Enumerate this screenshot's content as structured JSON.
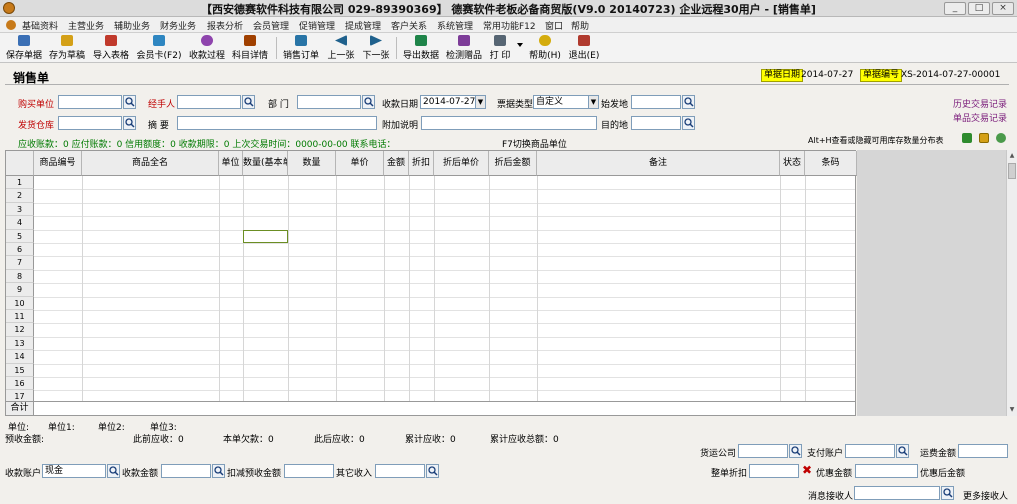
{
  "window": {
    "title": "【西安德赛软件科技有限公司 029-89390369】 德赛软件老板必备商贸版(V9.0 20140723) 企业远程30用户 - [销售单]",
    "controls": [
      "_",
      "□",
      "×"
    ]
  },
  "menu": [
    "基础资料",
    "主营业务",
    "辅助业务",
    "财务业务",
    "报表分析",
    "会员管理",
    "促销管理",
    "提成管理",
    "客户关系",
    "系统管理",
    "常用功能F12",
    "窗口",
    "帮助"
  ],
  "toolbar": [
    {
      "label": "保存单据",
      "icon": "save-icon",
      "color": "#3a6fb5"
    },
    {
      "label": "存为草稿",
      "icon": "draft-icon",
      "color": "#d4a017"
    },
    {
      "label": "导入表格",
      "icon": "import-icon",
      "color": "#c0392b"
    },
    {
      "label": "会员卡(F2)",
      "icon": "member-card-icon",
      "color": "#2e86c1"
    },
    {
      "label": "收款过程",
      "icon": "payment-icon",
      "color": "#8e44ad"
    },
    {
      "label": "科目详情",
      "icon": "subject-detail-icon",
      "color": "#a04000"
    },
    {
      "label": "销售订单",
      "icon": "sales-order-icon",
      "color": "#2874a6"
    },
    {
      "label": "上一张",
      "icon": "prev-icon",
      "color": "#1f618d"
    },
    {
      "label": "下一张",
      "icon": "next-icon",
      "color": "#1f618d"
    },
    {
      "label": "导出数据",
      "icon": "export-icon",
      "color": "#1e8449"
    },
    {
      "label": "检测赠品",
      "icon": "gift-check-icon",
      "color": "#7d3c98"
    },
    {
      "label": "打 印",
      "icon": "print-icon",
      "color": "#566573"
    },
    {
      "label": "帮助(H)",
      "icon": "help-icon",
      "color": "#d4ac0d"
    },
    {
      "label": "退出(E)",
      "icon": "exit-icon",
      "color": "#b03a2e"
    }
  ],
  "form": {
    "heading": "销售单",
    "doc_date_label": "单据日期",
    "doc_date": "2014-07-27",
    "doc_no_label": "单据编号",
    "doc_no": "XS-2014-07-27-00001",
    "buyer_label": "购买单位",
    "handler_label": "经手人",
    "dept_label": "部  门",
    "collect_date_label": "收款日期",
    "collect_date": "2014-07-27",
    "bill_type_label": "票据类型",
    "bill_type": "自定义",
    "origin_label": "始发地",
    "warehouse_label": "发货仓库",
    "summary_label": "摘  要",
    "extra_label": "附加说明",
    "dest_label": "目的地",
    "history_link": "历史交易记录",
    "item_history_link": "单品交易记录"
  },
  "infobar": {
    "text": "应收账款：0  应付账款：0  信用额度：0  收款期限：0  上次交易时间：0000-00-00  联系电话：",
    "f7_hint": "F7切换商品单位",
    "alt_hint": "Alt+H查看或隐藏可用库存数量分布表"
  },
  "table": {
    "columns": [
      "商品编号",
      "商品全名",
      "单位",
      "数量(基本单位)",
      "数量",
      "单价",
      "金额",
      "折扣",
      "折后单价",
      "折后金额",
      "备注",
      "状态",
      "条码"
    ],
    "rows": [
      "1",
      "2",
      "3",
      "4",
      "5",
      "6",
      "7",
      "8",
      "9",
      "10",
      "11",
      "12",
      "13",
      "14",
      "15",
      "16",
      "17"
    ],
    "total_label": "合计"
  },
  "footer": {
    "unit_label": "单位:",
    "unit1_label": "单位1:",
    "unit2_label": "单位2:",
    "unit3_label": "单位3:",
    "prepaid": "预收金额:",
    "prev_receivable": "此前应收：0",
    "current_debt": "本单欠款：0",
    "after_receivable": "此后应收：0",
    "cum_receivable": "累计应收：0",
    "cum_receivable_total": "累计应收总额：0",
    "shipping_company_label": "货运公司",
    "pay_account_label": "支付账户",
    "freight_label": "运费金额",
    "collect_account_label": "收款账户",
    "collect_account": "现金",
    "collect_amount_label": "收款金额",
    "deduct_prepaid_label": "扣减预收金额",
    "other_income_label": "其它收入",
    "whole_discount_label": "整单折扣",
    "discount_amount_label": "优惠金额",
    "after_discount_label": "优惠后金额",
    "msg_receiver_label": "消息接收人",
    "more_receivers": "更多接收人"
  }
}
